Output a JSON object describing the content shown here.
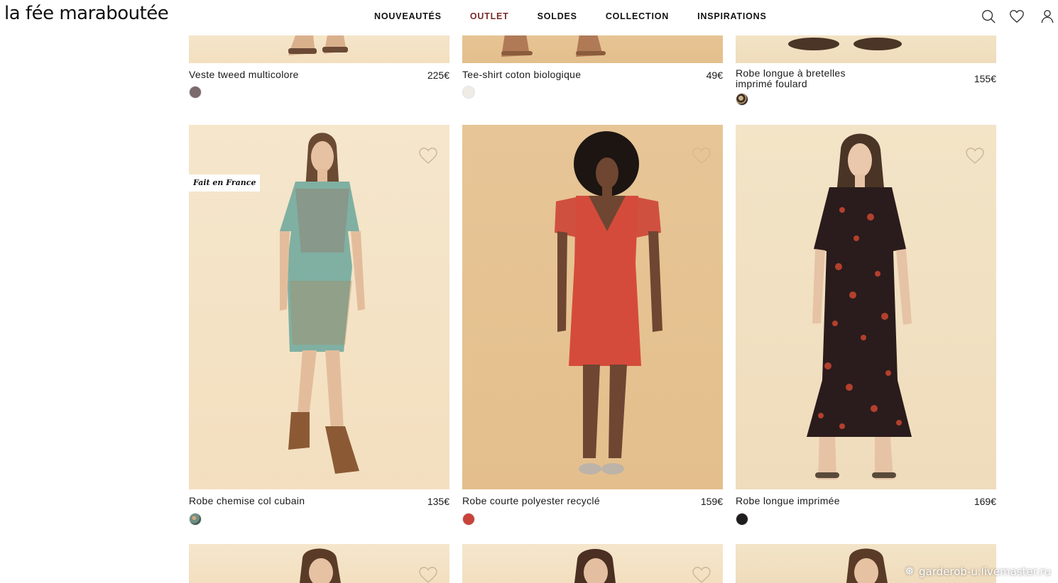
{
  "header": {
    "logo": "la fée maraboutée",
    "nav": [
      "NOUVEAUTÉS",
      "OUTLET",
      "SOLDES",
      "COLLECTION",
      "INSPIRATIONS"
    ],
    "active_nav": "OUTLET",
    "icons": [
      "search-icon",
      "heart-icon",
      "user-icon"
    ]
  },
  "products_top": [
    {
      "name": "Veste tweed multicolore",
      "price": "225€",
      "swatch": "#7a6a6c"
    },
    {
      "name": "Tee-shirt coton biologique",
      "price": "49€",
      "swatch": "#f0ebe6"
    },
    {
      "name": "Robe longue à bretelles imprimé foulard",
      "price": "155€",
      "swatch": "#6a5a4a"
    }
  ],
  "products_mid": [
    {
      "name": "Robe chemise col cubain",
      "price": "135€",
      "swatch": "#6f8e83",
      "badge": "Fait en France"
    },
    {
      "name": "Robe courte polyester recyclé",
      "price": "159€",
      "swatch": "#c8433a"
    },
    {
      "name": "Robe longue imprimée",
      "price": "169€",
      "swatch": "#1f1d1d"
    }
  ],
  "colors": {
    "active_nav": "#7a2b2b",
    "photo_bg_light": "#f4e3c5",
    "photo_bg_warm": "#e6c392"
  },
  "watermark": "garderob-u.livemaster.ru"
}
